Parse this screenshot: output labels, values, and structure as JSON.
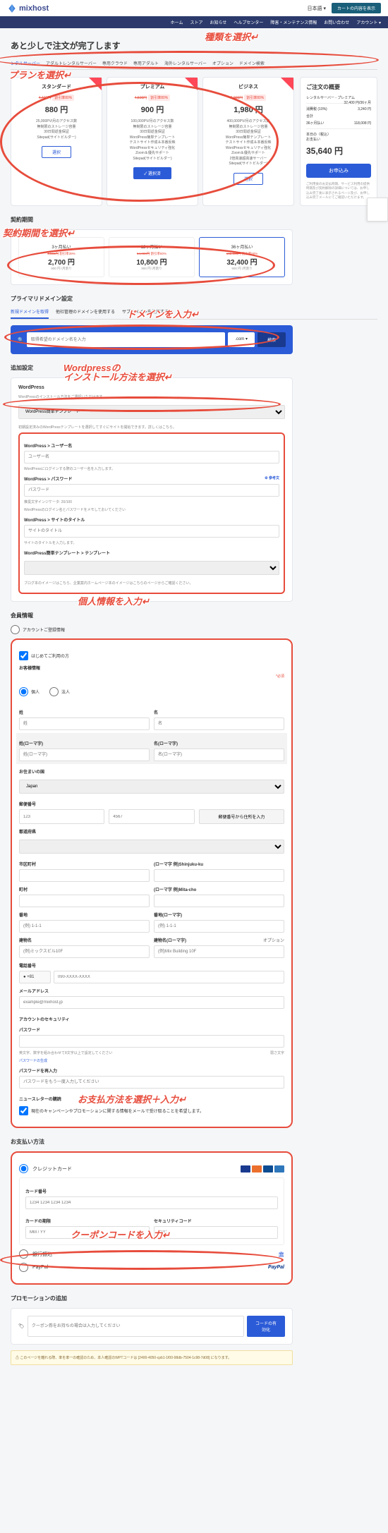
{
  "topbar": {
    "lang": "日本語 ▾",
    "cart": "カートの内容を表示"
  },
  "logo": "mixhost",
  "nav": [
    "ホーム",
    "ストア",
    "お知らせ",
    "ヘルプセンター",
    "障害・メンテナンス情報",
    "お問い合わせ",
    "アカウント ▾"
  ],
  "h1": "あと少しで注文が完了します",
  "tabs": [
    "ンタルサーバー",
    "アダルトレンタルサーバー",
    "専用クラウド",
    "専用アダルト",
    "海外レンタルサーバー",
    "オプション",
    "ドメイン検索"
  ],
  "plans": [
    {
      "name": "スタンダード",
      "strike": "4,400円",
      "disc": "割引率80%",
      "price": "880 円",
      "feat": "25,000PV/月のアクセス数\n無制限のストレージ容量\n30日間返金保証\nSitepad(サイトビルダー)",
      "btn": "選択",
      "sel": false
    },
    {
      "name": "プレミアム",
      "strike": "4,500円",
      "disc": "割引率80%",
      "price": "900 円",
      "feat": "100,000PV/月のアクセス数\n無制限のストレージ容量\n30日間返金保証\nWordPress簡単テンプレート\nテストサイト作成＆本番反映\nWordPressセキュリティ強化\nZoom＆優先サポート\nSitepad(サイトビルダー)",
      "btn": "✓ 選択済",
      "sel": true
    },
    {
      "name": "ビジネス",
      "strike": "9,900円",
      "disc": "割引率80%",
      "price": "1,980 円",
      "feat": "400,000PV/月のアクセス数\n無制限のストレージ容量\n30日間返金保証\nWordPress簡単テンプレート\nテストサイト作成＆本番反映\nWordPressセキュリティ強化\nZoom＆優先サポート\n2倍高速超高速サーバー\nSitepad(サイトビルダー)",
      "btn": "選択",
      "sel": false
    }
  ],
  "summary": {
    "title": "ご注文の概要",
    "item": "レンタルサーバー - プレミアム",
    "item_price": "32,400 円/36ヶ月",
    "rows": [
      [
        "消費税 (10%)",
        "3,240 円"
      ],
      [
        "合計",
        ""
      ],
      [
        "36ヶ月払い",
        "118,008 円"
      ]
    ],
    "today_lbl": "本日の（税込）",
    "today_sub": "お支払い",
    "total": "35,640 円",
    "btn": "お申込み",
    "note": "ご利用後のお支払時期、サービス利用の提供時期及び契約解除の詳細については、お申し込み完了後に表示されるページ及び、お申し込み完了メールにてご確認いただけます。"
  },
  "contract": {
    "title": "契約期間",
    "terms": [
      {
        "label": "3ヶ月払い",
        "strike": "4,500円",
        "disc": "割引率39%",
        "price": "2,700 円",
        "sub": "900 円 /月割り"
      },
      {
        "label": "12ヶ月払い",
        "strike": "54,000円",
        "disc": "割引率80%",
        "price": "10,800 円",
        "sub": "900 円 /月割り"
      },
      {
        "label": "36ヶ月払い",
        "strike": "162,000円",
        "disc": "割引率80%",
        "price": "32,400 円",
        "sub": "900 円 /月割り"
      }
    ]
  },
  "domain": {
    "title": "プライマリドメイン設定",
    "tabs": [
      "新規ドメインを取得",
      "他社管理のドメインを使用する",
      "サブドメインを使用する"
    ],
    "placeholder": "取得希望のドメイン名を入力",
    "tld": ".com ▾",
    "btn": "検索"
  },
  "addon": {
    "title": "追加設定",
    "wp_title": "WordPress",
    "wp_note": "WordPressのインストール方法をご選択いただけます。",
    "select": "WordPress簡単テンプレート",
    "select_note": "初期設定済みのWordPressテンプレートを選択してすぐにサイトを開始できます。詳しくはこちら。",
    "user_lbl": "WordPress > ユーザー名",
    "user_ph": "ユーザー名",
    "user_note": "WordPressにログインする際のユーザー名を入力します。",
    "pw_lbl": "WordPress > パスワード",
    "pw_ph": "パスワード",
    "pw_link": "⚙ 参考文",
    "pw_note": "推奨文字インジケータ: 20/100",
    "pw_note2": "WordPressのログイン名とパスワードをメモしておいてください",
    "site_lbl": "WordPress > サイトのタイトル",
    "site_ph": "サイトのタイトル",
    "site_note": "サイトのタイトルを入力します。",
    "tpl_lbl": "WordPress簡単テンプレート > テンプレート",
    "tpl_ph": "",
    "tpl_note": "ブログ本のイメージはこちら、企業案内ホームページ本のイメージはこちらのページからご確認ください。"
  },
  "account": {
    "title": "会員情報",
    "sub": "アカウントご登録情報",
    "first_time": "はじめてご利用の方",
    "cust_title": "お客様情報",
    "type": [
      "個人",
      "法人"
    ],
    "req": "*必須",
    "fields": {
      "sei": "姓",
      "mei": "名",
      "sei_r": "姓(ローマ字)",
      "mei_r": "名(ローマ字)",
      "country": "お住まいの国",
      "country_v": "Japan",
      "zip_lbl": "郵便番号",
      "zip1": "123",
      "zip2": "4567",
      "zip_btn": "郵便番号から住所を入力",
      "pref": "都道府県",
      "city": "市区町村",
      "city_r": "(ローマ字  例)Shinjuku-ku",
      "town": "町村",
      "town_r": "(ローマ字  例)Mita-cho",
      "addr": "番地",
      "addr_ph": "(例) 1-1-1",
      "addr_r": "番地(ローマ字)",
      "addr_r_ph": "(例) 1-1-1",
      "bldg": "建物名",
      "bldg_ph": "(例)ミックスビル10F",
      "bldg_r": "建物名(ローマ字)",
      "bldg_r_ph": "(例)Mix Building 10F",
      "opt": "オプション",
      "tel": "電話番号",
      "tel_pref": "● +81",
      "tel_ph": "090-XXXX-XXXX",
      "email": "メールアドレス",
      "email_ph": "example@mixhost.jp"
    },
    "sec": {
      "title": "アカウントのセキュリティ",
      "pw1": "パスワード",
      "pw1_note": "英文字、数字を組み合わせて8文字以上で設定してください",
      "strength": "弱さ文字",
      "gen": "パスワードの生成",
      "pw2": "パスワードを再入力",
      "pw2_ph": "パスワードをもう一度入力してください"
    },
    "news": {
      "title": "ニュースレターの購読",
      "check": "現在のキャンペーンやプロモーションに関する情報をメールで受け取ることを希望します。"
    }
  },
  "payment": {
    "title": "お支払い方法",
    "credit": "クレジットカード",
    "card_no": "カード番号",
    "card_ph": "1234 1234 1234 1234",
    "exp": "カードの期限",
    "exp_ph": "MM / YY",
    "cvc": "セキュリティコード",
    "cvc_ph": "CVC",
    "bank": "銀行振込",
    "paypal": "PayPal"
  },
  "promo": {
    "title": "プロモーションの追加",
    "placeholder": "クーポン券をお持ちの場合は入力してください",
    "btn": "コードの有効化"
  },
  "warning": "このページを離れる際、率を率一の確認のため、本人確認のWPTコードは [2400-4050-cpb1-1f00-98db-7504-1c98-7d08] になります。",
  "anno": {
    "a1": "種類を選択",
    "a2": "プランを選択",
    "a3": "契約期間を選択",
    "a4": "ドメインを入力",
    "a5": "Wordpressの",
    "a5b": "インストール方法を選択",
    "a6": "個人情報を入力",
    "a7": "お支払方法を選択＋入力",
    "a8": "クーポンコードを入力"
  }
}
